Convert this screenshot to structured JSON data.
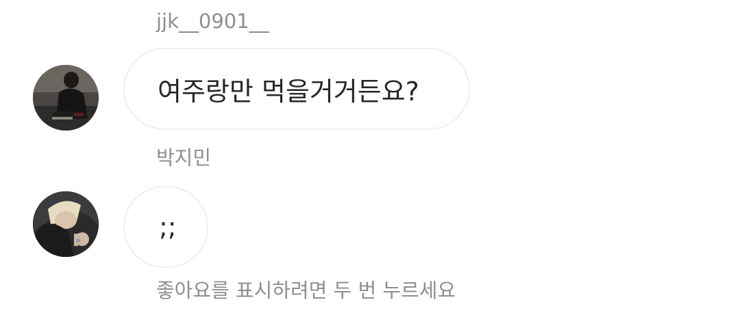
{
  "thread": {
    "messages": [
      {
        "sender": "jjk__0901__",
        "avatar_icon": "user-avatar-photo",
        "text": "여주랑만 먹을거거든요?"
      },
      {
        "sender": "박지민",
        "avatar_icon": "user-avatar-photo",
        "text": ";;"
      }
    ],
    "like_hint": "좋아요를 표시하려면 두 번 누르세요"
  },
  "colors": {
    "meta_text": "#8e8e8e",
    "message_text": "#262626",
    "bubble_border": "#efefef",
    "background": "#ffffff"
  }
}
